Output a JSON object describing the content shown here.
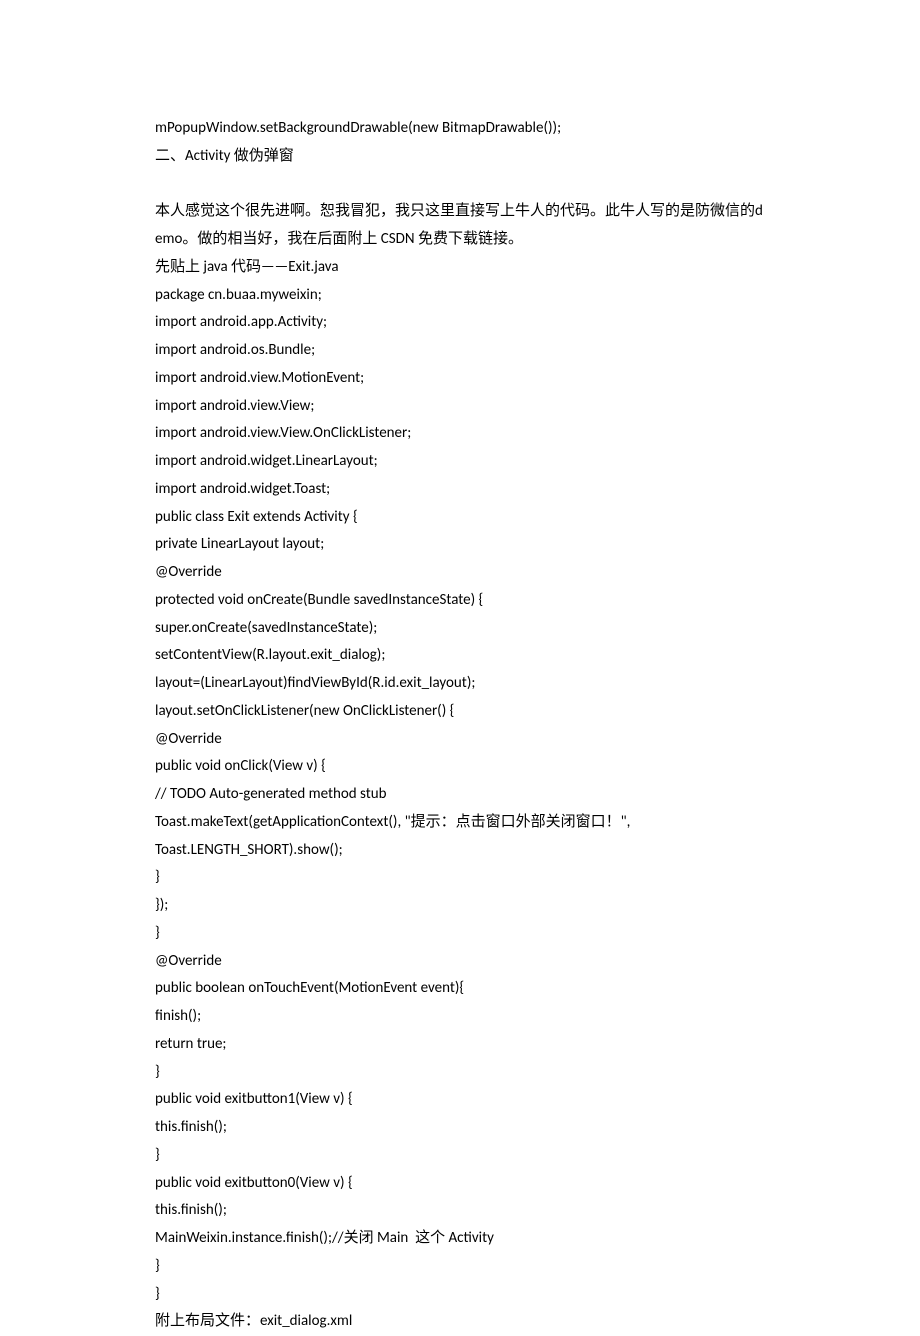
{
  "lines": [
    "mPopupWindow.setBackgroundDrawable(new BitmapDrawable());",
    "二、Activity 做伪弹窗",
    "",
    "本人感觉这个很先进啊。恕我冒犯，我只这里直接写上牛人的代码。此牛人写的是防微信的demo。做的相当好，我在后面附上 CSDN 免费下载链接。",
    "先贴上 java 代码——Exit.java",
    "package cn.buaa.myweixin;",
    "import android.app.Activity;",
    "import android.os.Bundle;",
    "import android.view.MotionEvent;",
    "import android.view.View;",
    "import android.view.View.OnClickListener;",
    "import android.widget.LinearLayout;",
    "import android.widget.Toast;",
    "public class Exit extends Activity {",
    "private LinearLayout layout;",
    "@Override",
    "protected void onCreate(Bundle savedInstanceState) {",
    "super.onCreate(savedInstanceState);",
    "setContentView(R.layout.exit_dialog);",
    "layout=(LinearLayout)findViewById(R.id.exit_layout);",
    "layout.setOnClickListener(new OnClickListener() {",
    "@Override",
    "public void onClick(View v) {",
    "// TODO Auto-generated method stub",
    "Toast.makeText(getApplicationContext(), \"提示：点击窗口外部关闭窗口！\",",
    "Toast.LENGTH_SHORT).show();",
    "}",
    "});",
    "}",
    "@Override",
    "public boolean onTouchEvent(MotionEvent event){",
    "finish();",
    "return true;",
    "}",
    "public void exitbutton1(View v) {",
    "this.finish();",
    "}",
    "public void exitbutton0(View v) {",
    "this.finish();",
    "MainWeixin.instance.finish();//关闭 Main  这个 Activity",
    "}",
    "}",
    "附上布局文件：exit_dialog.xml"
  ]
}
